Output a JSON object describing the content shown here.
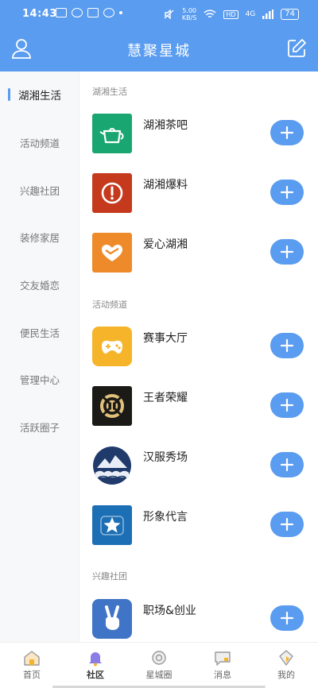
{
  "status_bar": {
    "time": "14:43",
    "speed_value": "5.00",
    "speed_unit": "KB/S",
    "hd": "HD",
    "signal": "4G",
    "battery": "74"
  },
  "header": {
    "title": "慧聚星城"
  },
  "sidebar": {
    "items": [
      {
        "label": "湖湘生活"
      },
      {
        "label": "活动频道"
      },
      {
        "label": "兴趣社团"
      },
      {
        "label": "装修家居"
      },
      {
        "label": "交友婚恋"
      },
      {
        "label": "便民生活"
      },
      {
        "label": "管理中心"
      },
      {
        "label": "活跃圈子"
      }
    ]
  },
  "sections": [
    {
      "title": "湖湘生活",
      "items": [
        {
          "label": "湖湘茶吧",
          "color": "#1aa671",
          "icon": "teapot-icon"
        },
        {
          "label": "湖湘爆料",
          "color": "#c53a1d",
          "icon": "alert-icon"
        },
        {
          "label": "爱心湖湘",
          "color": "#ee8a2a",
          "icon": "heart-icon"
        }
      ]
    },
    {
      "title": "活动频道",
      "items": [
        {
          "label": "赛事大厅",
          "color": "#f5b42a",
          "icon": "gamepad-icon"
        },
        {
          "label": "王者荣耀",
          "color": "#1c1a17",
          "icon": "game-logo-icon"
        },
        {
          "label": "汉服秀场",
          "color": "#ffffff",
          "icon": "mountain-cloud-icon"
        },
        {
          "label": "形象代言",
          "color": "#1c6fb5",
          "icon": "star-icon"
        }
      ]
    },
    {
      "title": "兴趣社团",
      "items": [
        {
          "label": "职场&创业",
          "color": "#3f74c6",
          "icon": "victory-hand-icon"
        }
      ]
    }
  ],
  "tabbar": {
    "tabs": [
      {
        "label": "首页",
        "icon": "home-icon"
      },
      {
        "label": "社区",
        "icon": "bell-icon"
      },
      {
        "label": "星城圈",
        "icon": "camera-icon"
      },
      {
        "label": "消息",
        "icon": "message-icon"
      },
      {
        "label": "我的",
        "icon": "profile-icon"
      }
    ],
    "active": "社区",
    "accent": "#5a9cef"
  }
}
